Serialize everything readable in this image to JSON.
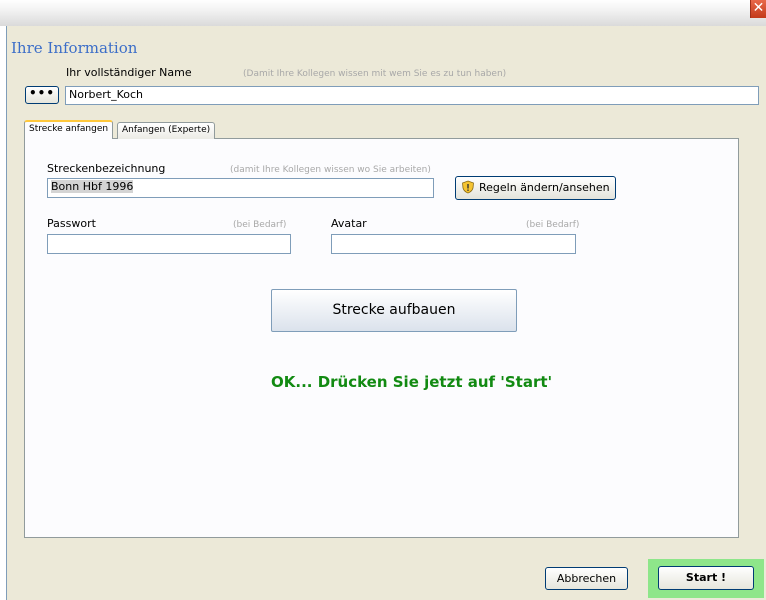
{
  "window": {
    "close_glyph": "✕"
  },
  "info": {
    "heading": "Ihre Information",
    "name_label": "Ihr vollständiger Name",
    "name_hint": "(Damit Ihre Kollegen wissen mit wem Sie es zu tun haben)",
    "dots_label": "•••",
    "name_value": "Norbert_Koch"
  },
  "tabs": [
    {
      "label": "Strecke anfangen",
      "active": true
    },
    {
      "label": "Anfangen (Experte)",
      "active": false
    }
  ],
  "route": {
    "label": "Streckenbezeichnung",
    "hint": "(damit Ihre Kollegen wissen wo Sie arbeiten)",
    "value": "Bonn Hbf 1996",
    "rules_button": "Regeln ändern/ansehen",
    "rules_icon": "shield-icon"
  },
  "password": {
    "label": "Passwort",
    "hint": "(bei Bedarf)",
    "value": ""
  },
  "avatar": {
    "label": "Avatar",
    "hint": "(bei Bedarf)",
    "value": ""
  },
  "build_button": "Strecke aufbauen",
  "status_message": "OK... Drücken Sie jetzt auf 'Start'",
  "colors": {
    "status": "#128a12",
    "heading": "#3c6ec8",
    "start_highlight": "#8ee68a"
  },
  "footer": {
    "cancel_button": "Abbrechen",
    "start_button": "Start !"
  }
}
